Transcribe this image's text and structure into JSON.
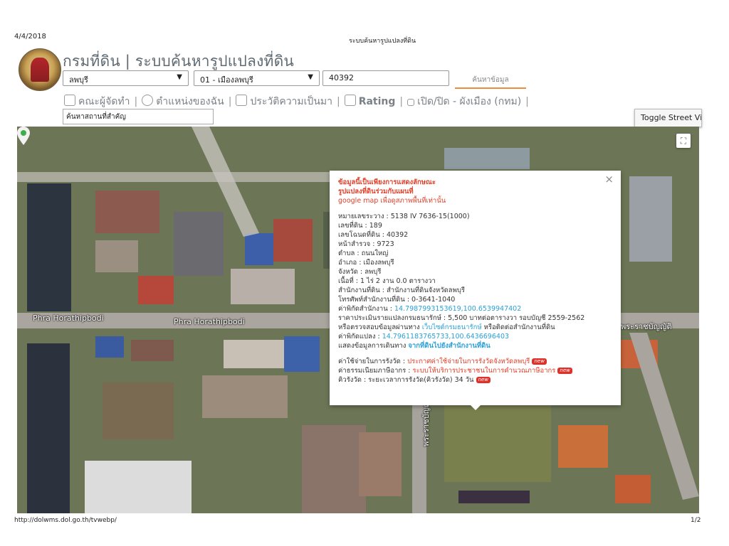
{
  "print": {
    "date": "4/4/2018",
    "page_title": "ระบบค้นหารูปแปลงที่ดิน",
    "url": "http://dolwms.dol.go.th/tvwebp/",
    "page_number": "1/2"
  },
  "header": {
    "title": "กรมที่ดิน | ระบบค้นหารูปแปลงที่ดิน"
  },
  "search": {
    "province": "ลพบุรี",
    "district": "01 - เมืองลพบุรี",
    "parcel_no": "40392",
    "button": "ค้นหาข้อมูล",
    "landmark_placeholder": "ค้นหาสถานที่สำคัญ"
  },
  "links": {
    "credits": "คณะผู้จัดทำ",
    "my_location": "ตำแหน่งของฉัน",
    "history": "ประวัติความเป็นมา",
    "rating": "Rating",
    "toggle_layer": "เปิด/ปิด - ผังเมือง (กทม)"
  },
  "street_view_button": "Toggle Street Vi",
  "map": {
    "road_labels": [
      "Phra Horathipbodi",
      "Phra Horathipbodi",
      "พระราชบัญญัติ",
      "พระราชบัญญัติ"
    ],
    "fullscreen_icon": "fullscreen-icon"
  },
  "popup": {
    "notice": [
      "ข้อมูลนี้เป็นเพียงการแสดงลักษณะ",
      "รูปแปลงที่ดินร่วมกับแผนที่",
      "google map เพื่อดูสภาพพื้นที่เท่านั้น"
    ],
    "fields": [
      "หมายเลขระวาง : 5138 IV 7636-15(1000)",
      "เลขที่ดิน : 189",
      "เลขโฉนดที่ดิน : 40392",
      "หน้าสำรวจ : 9723",
      "ตำบล : ถนนใหญ่",
      "อำเภอ : เมืองลพบุรี",
      "จังหวัด : ลพบุรี",
      "เนื้อที่ : 1 ไร่ 2 งาน 0.0 ตารางวา",
      "สำนักงานที่ดิน : สำนักงานที่ดินจังหวัดลพบุรี",
      "โทรศัพท์สำนักงานที่ดิน : 0-3641-1040"
    ],
    "office_coord_label": "ค่าพิกัดสำนักงาน : ",
    "office_coord": "14.7987993153619,100.6539947402",
    "appraisal": "ราคาประเมินรายแปลงกรมธนารักษ์ : 5,500 บาทต่อตารางวา รอบบัญชี 2559-2562",
    "check_prefix": "หรือตรวจสอบข้อมูลผ่านทาง ",
    "check_link": "เว็บไซต์กรมธนารักษ์",
    "check_suffix": " หรือติดต่อสำนักงานที่ดิน",
    "parcel_coord_label": "ค่าพิกัดแปลง : ",
    "parcel_coord": "14.7961183765733,100.6436696403",
    "route_prefix": "แสดงข้อมูลการเดินทาง ",
    "route_link": "จากที่ดินไปยังสำนักงานที่ดิน",
    "fee_label": "ค่าใช้จ่ายในการรังวัด : ",
    "fee_link": "ประกาศค่าใช้จ่ายในการรังวัดจังหวัดลพบุรี",
    "tax_label": "ค่าธรรมเนียมภาษีอากร : ",
    "tax_link": "ระบบให้บริการประชาชนในการคำนวณภาษีอากร",
    "queue_label": "คิวรังวัด : ระยะเวลาการรังวัด(คิวรังวัด) 34 วัน",
    "new_badge": "new",
    "close_icon": "close-icon"
  }
}
